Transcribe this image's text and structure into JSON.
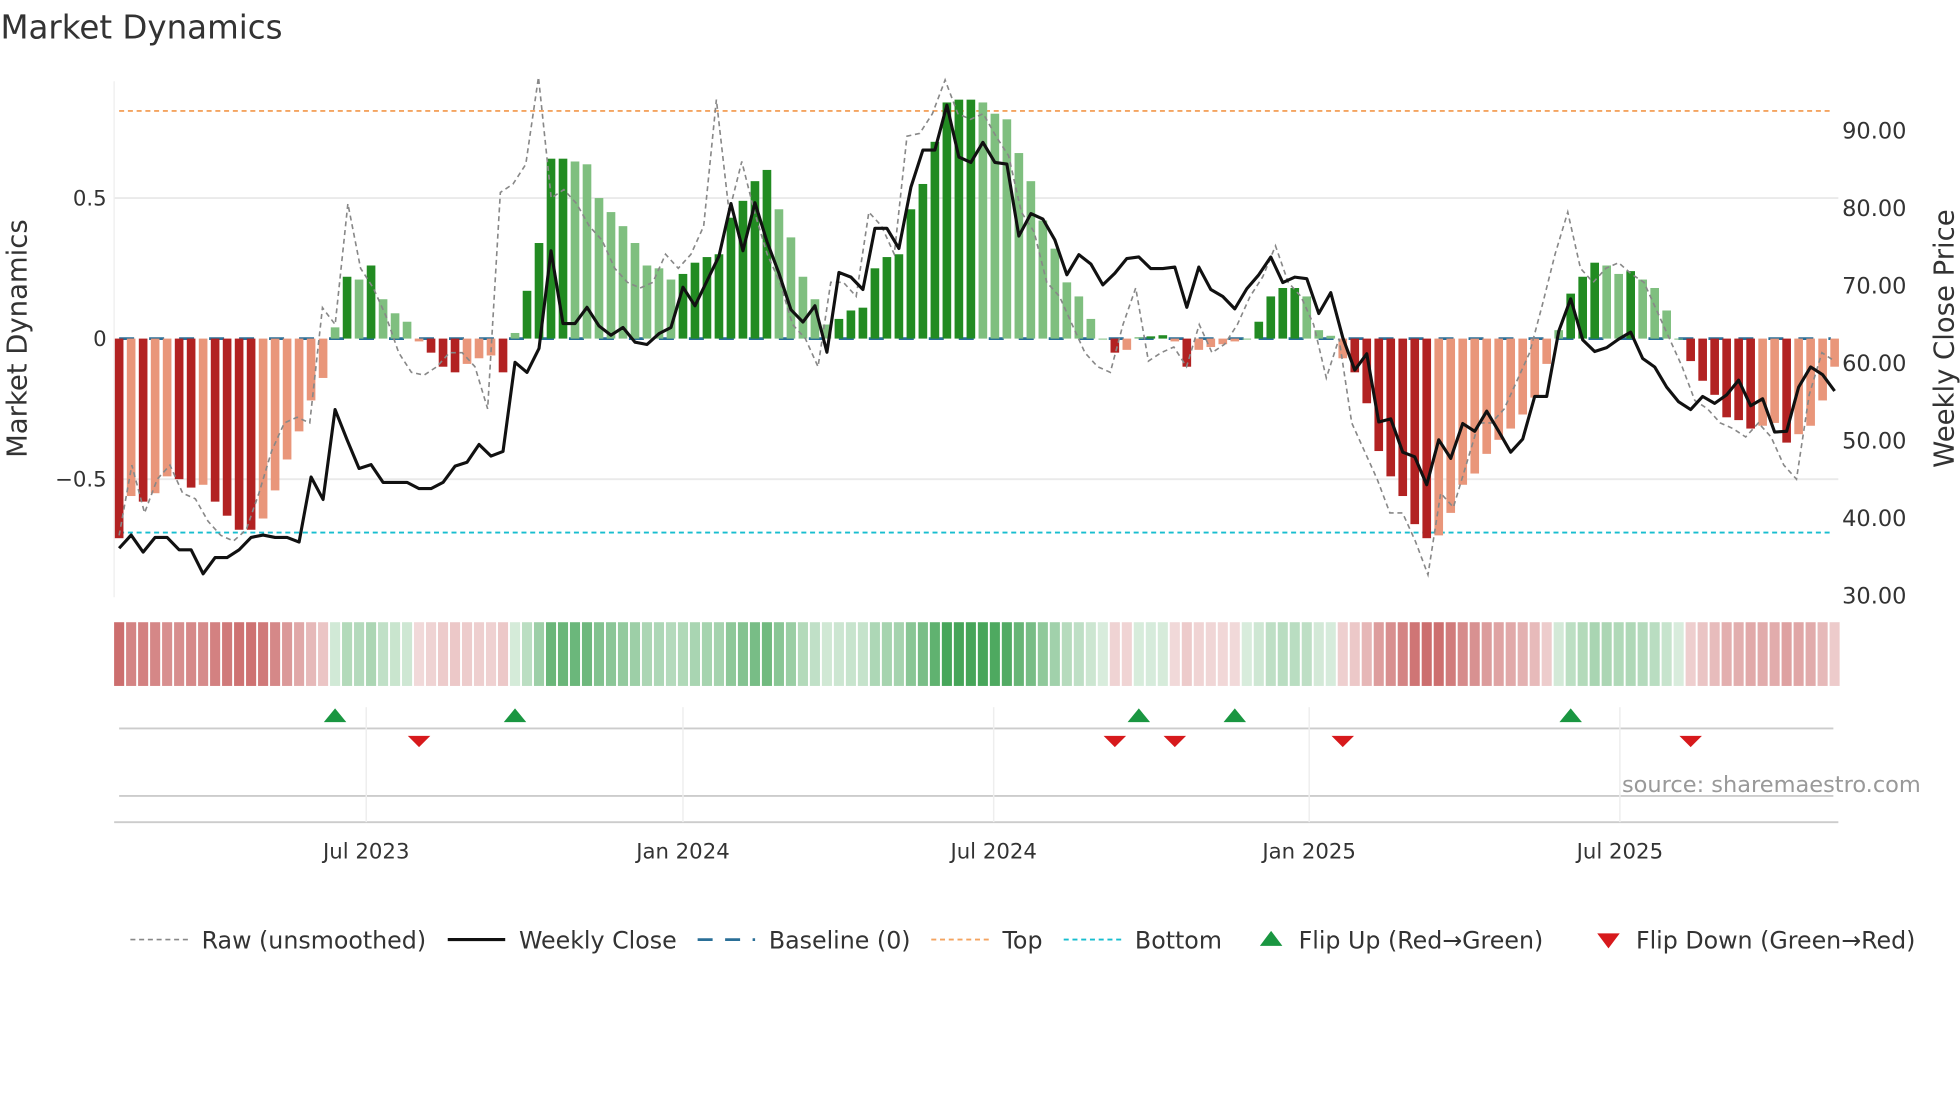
{
  "chart_data": {
    "type": "bar",
    "title": "Market Dynamics",
    "ylabel": "Market Dynamics",
    "y2label": "Weekly Close Price",
    "ylim": [
      -0.93,
      0.93
    ],
    "y2lim": [
      30,
      95
    ],
    "yticks": [
      {
        "v": 0.5,
        "label": "0.5"
      },
      {
        "v": 0,
        "label": "0"
      },
      {
        "v": -0.5,
        "label": "−0.5"
      }
    ],
    "y2ticks": [
      {
        "v": 90,
        "label": "90.00"
      },
      {
        "v": 80,
        "label": "80.00"
      },
      {
        "v": 70,
        "label": "70.00"
      },
      {
        "v": 60,
        "label": "60.00"
      },
      {
        "v": 50,
        "label": "50.00"
      },
      {
        "v": 40,
        "label": "40.00"
      },
      {
        "v": 30,
        "label": "30.00"
      }
    ],
    "xticks": [
      {
        "week": 20.6,
        "label": "Jul 2023"
      },
      {
        "week": 47,
        "label": "Jan 2024"
      },
      {
        "week": 72.9,
        "label": "Jul 2024"
      },
      {
        "week": 99.2,
        "label": "Jan 2025"
      },
      {
        "week": 125.1,
        "label": "Jul 2025"
      }
    ],
    "top_level": 0.81,
    "bottom_level": -0.69,
    "baseline": 0,
    "momentum": [
      -0.71,
      -0.56,
      -0.58,
      -0.55,
      -0.49,
      -0.5,
      -0.53,
      -0.52,
      -0.58,
      -0.63,
      -0.68,
      -0.68,
      -0.64,
      -0.54,
      -0.43,
      -0.33,
      -0.22,
      -0.14,
      0.04,
      0.22,
      0.21,
      0.26,
      0.14,
      0.09,
      0.06,
      -0.01,
      -0.05,
      -0.1,
      -0.12,
      -0.09,
      -0.07,
      -0.06,
      -0.12,
      0.02,
      0.17,
      0.34,
      0.64,
      0.64,
      0.63,
      0.62,
      0.5,
      0.45,
      0.4,
      0.34,
      0.26,
      0.25,
      0.21,
      0.23,
      0.27,
      0.29,
      0.3,
      0.43,
      0.49,
      0.56,
      0.6,
      0.46,
      0.36,
      0.22,
      0.14,
      0.05,
      0.07,
      0.1,
      0.11,
      0.25,
      0.29,
      0.3,
      0.46,
      0.55,
      0.7,
      0.84,
      0.85,
      0.85,
      0.84,
      0.8,
      0.78,
      0.66,
      0.56,
      0.42,
      0.32,
      0.2,
      0.15,
      0.07,
      0.0,
      -0.05,
      -0.04,
      0.005,
      0.008,
      0.012,
      -0.01,
      -0.1,
      -0.04,
      -0.03,
      -0.02,
      -0.01,
      0.0,
      0.06,
      0.15,
      0.18,
      0.18,
      0.15,
      0.03,
      0.01,
      -0.07,
      -0.12,
      -0.23,
      -0.4,
      -0.49,
      -0.56,
      -0.66,
      -0.71,
      -0.7,
      -0.62,
      -0.52,
      -0.48,
      -0.41,
      -0.36,
      -0.32,
      -0.27,
      -0.21,
      -0.09,
      0.03,
      0.16,
      0.22,
      0.27,
      0.26,
      0.23,
      0.24,
      0.21,
      0.18,
      0.1,
      0.0,
      -0.08,
      -0.15,
      -0.2,
      -0.28,
      -0.29,
      -0.32,
      -0.31,
      -0.3,
      -0.37,
      -0.34,
      -0.31,
      -0.22,
      -0.1
    ],
    "close": [
      36.0,
      37.7,
      35.5,
      37.4,
      37.4,
      35.8,
      35.8,
      32.7,
      34.8,
      34.8,
      35.8,
      37.4,
      37.7,
      37.4,
      37.4,
      36.8,
      45.2,
      42.3,
      53.9,
      50,
      46.3,
      46.8,
      44.5,
      44.5,
      44.5,
      43.7,
      43.7,
      44.5,
      46.6,
      47.1,
      49.4,
      47.9,
      48.5,
      60,
      58.7,
      61.8,
      74.4,
      65,
      65,
      67.1,
      64.7,
      63.5,
      64.5,
      62.6,
      62.3,
      63.7,
      64.5,
      69.7,
      67.3,
      70.5,
      73.7,
      80.5,
      74.4,
      80.6,
      75.6,
      71.5,
      66.8,
      65.2,
      67.3,
      61.3,
      71.6,
      71,
      69.4,
      77.3,
      77.3,
      74.7,
      82.6,
      87.4,
      87.4,
      93.2,
      86.5,
      85.8,
      88.4,
      85.8,
      85.6,
      76.3,
      79.2,
      78.5,
      75.8,
      71.3,
      73.9,
      72.7,
      70,
      71.5,
      73.4,
      73.6,
      72.1,
      72.1,
      72.3,
      67.1,
      72.3,
      69.4,
      68.5,
      66.9,
      69.5,
      71.3,
      73.6,
      70.3,
      71,
      70.8,
      66.3,
      69,
      63.2,
      59,
      61.1,
      52.3,
      52.7,
      48.4,
      47.8,
      44.2,
      50,
      47.6,
      52.1,
      51.1,
      53.7,
      51.1,
      48.4,
      50.1,
      55.6,
      55.6,
      64,
      68.2,
      62.9,
      61.4,
      61.9,
      63,
      63.9,
      60.5,
      59.4,
      56.8,
      54.9,
      53.9,
      55.6,
      54.7,
      55.8,
      57.7,
      54.4,
      55.3,
      51,
      51.1,
      56.8,
      59.4,
      58.4,
      56.3
    ],
    "raw": [
      -0.7,
      -0.45,
      -0.62,
      -0.5,
      -0.45,
      -0.55,
      -0.57,
      -0.65,
      -0.7,
      -0.72,
      -0.68,
      -0.55,
      -0.4,
      -0.3,
      -0.28,
      -0.3,
      0.11,
      0.05,
      0.48,
      0.25,
      0.18,
      0.08,
      -0.05,
      -0.12,
      -0.13,
      -0.1,
      -0.05,
      -0.05,
      -0.1,
      -0.25,
      0.52,
      0.55,
      0.62,
      0.93,
      0.5,
      0.53,
      0.48,
      0.4,
      0.35,
      0.25,
      0.2,
      0.18,
      0.2,
      0.3,
      0.25,
      0.3,
      0.4,
      0.85,
      0.45,
      0.63,
      0.45,
      0.3,
      0.2,
      0.05,
      0.0,
      -0.1,
      0.2,
      0.2,
      0.15,
      0.45,
      0.4,
      0.3,
      0.72,
      0.73,
      0.8,
      0.92,
      0.8,
      0.78,
      0.8,
      0.72,
      0.65,
      0.45,
      0.38,
      0.2,
      0.15,
      0.05,
      -0.05,
      -0.1,
      -0.12,
      0.05,
      0.18,
      -0.08,
      -0.05,
      -0.03,
      -0.1,
      0.05,
      -0.05,
      -0.02,
      0.05,
      0.15,
      0.22,
      0.33,
      0.2,
      0.15,
      0.05,
      -0.14,
      0.0,
      -0.3,
      -0.4,
      -0.5,
      -0.62,
      -0.62,
      -0.72,
      -0.84,
      -0.55,
      -0.6,
      -0.45,
      -0.3,
      -0.3,
      -0.25,
      -0.15,
      -0.05,
      0.12,
      0.3,
      0.45,
      0.25,
      0.2,
      0.25,
      0.27,
      0.23,
      0.2,
      0.1,
      0.0,
      -0.1,
      -0.22,
      -0.25,
      -0.3,
      -0.32,
      -0.35,
      -0.3,
      -0.35,
      -0.45,
      -0.5,
      -0.2,
      -0.05,
      -0.08
    ],
    "flip_up_weeks": [
      18,
      33,
      85,
      93,
      121
    ],
    "flip_down_weeks": [
      25,
      83,
      88,
      102,
      131
    ],
    "colors": {
      "pos_strong": "#228b22",
      "pos_weak": "#7fbf7f",
      "neg_strong": "#b22222",
      "neg_weak": "#e9967a",
      "close": "#111111",
      "raw": "#888888",
      "baseline": "#2a6f97",
      "top": "#f4a460",
      "bottom": "#17becf",
      "flip_up": "#1a9641",
      "flip_down": "#d7191c"
    },
    "legend": {
      "placement": "bottom",
      "items": [
        {
          "key": "raw",
          "label": "Raw (unsmoothed)"
        },
        {
          "key": "close",
          "label": "Weekly Close"
        },
        {
          "key": "baseline",
          "label": "Baseline (0)"
        },
        {
          "key": "top",
          "label": "Top"
        },
        {
          "key": "bottom",
          "label": "Bottom"
        },
        {
          "key": "flip_up",
          "label": "Flip Up (Red→Green)"
        },
        {
          "key": "flip_down",
          "label": "Flip Down (Green→Red)"
        }
      ]
    },
    "source": "source: sharemaestro.com"
  }
}
